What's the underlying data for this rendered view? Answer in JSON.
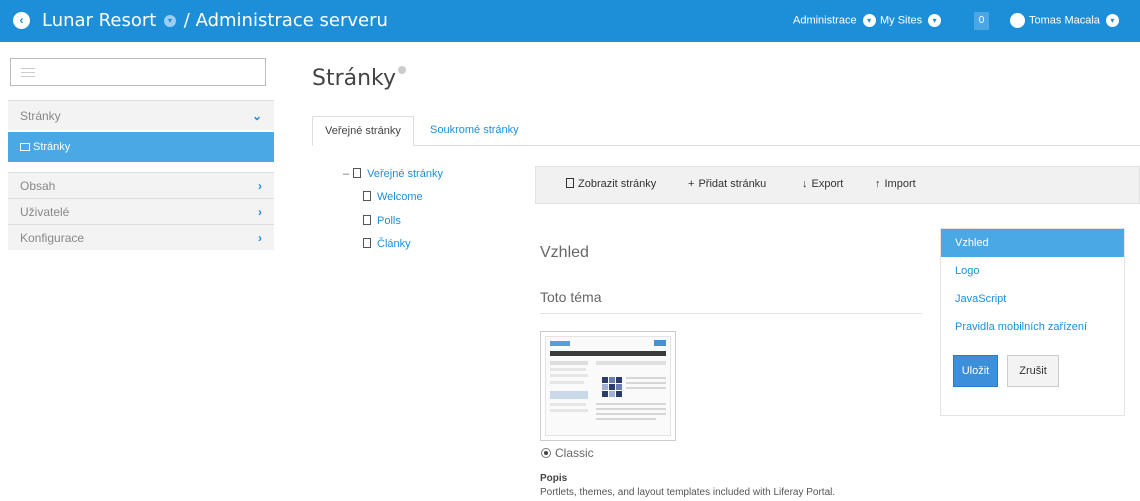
{
  "header": {
    "site_name": "Lunar Resort",
    "separator": "/",
    "section": "Administrace serveru",
    "menu_admin": "Administrace",
    "menu_sites": "My Sites",
    "notifications_count": "0",
    "user_name": "Tomas Macala",
    "caret_glyph": "▾"
  },
  "sidebar": {
    "items": [
      {
        "label": "Stránky",
        "chevron": "⌄",
        "expanded": true
      },
      {
        "label": "Stránky",
        "active": true
      },
      {
        "label": "Obsah",
        "chevron": "›"
      },
      {
        "label": "Uživatelé",
        "chevron": "›"
      },
      {
        "label": "Konfigurace",
        "chevron": "›"
      }
    ]
  },
  "main": {
    "title": "Stránky",
    "tabs": [
      {
        "label": "Veřejné stránky",
        "active": true
      },
      {
        "label": "Soukromé stránky",
        "active": false
      }
    ],
    "tree": {
      "root": "Veřejné stránky",
      "root_toggle": "–",
      "children": [
        "Welcome",
        "Polls",
        "Články"
      ]
    },
    "toolbar": {
      "view": "Zobrazit stránky",
      "add": "Přidat stránku",
      "add_icon": "+",
      "export": "Export",
      "export_icon": "↓",
      "import": "Import",
      "import_icon": "↑"
    },
    "section_title": "Vzhled",
    "theme_label": "Toto téma",
    "theme_name": "Classic",
    "description_heading": "Popis",
    "description_text": "Portlets, themes, and layout templates included with Liferay Portal."
  },
  "right_panel": {
    "items": [
      {
        "label": "Vzhled",
        "active": true
      },
      {
        "label": "Logo"
      },
      {
        "label": "JavaScript"
      },
      {
        "label": "Pravidla mobilních zařízení"
      }
    ],
    "save": "Uložit",
    "cancel": "Zrušit"
  },
  "colors": {
    "accent": "#1d8fd9",
    "active_item": "#4aa8e4",
    "button_primary": "#3c8fd9"
  }
}
